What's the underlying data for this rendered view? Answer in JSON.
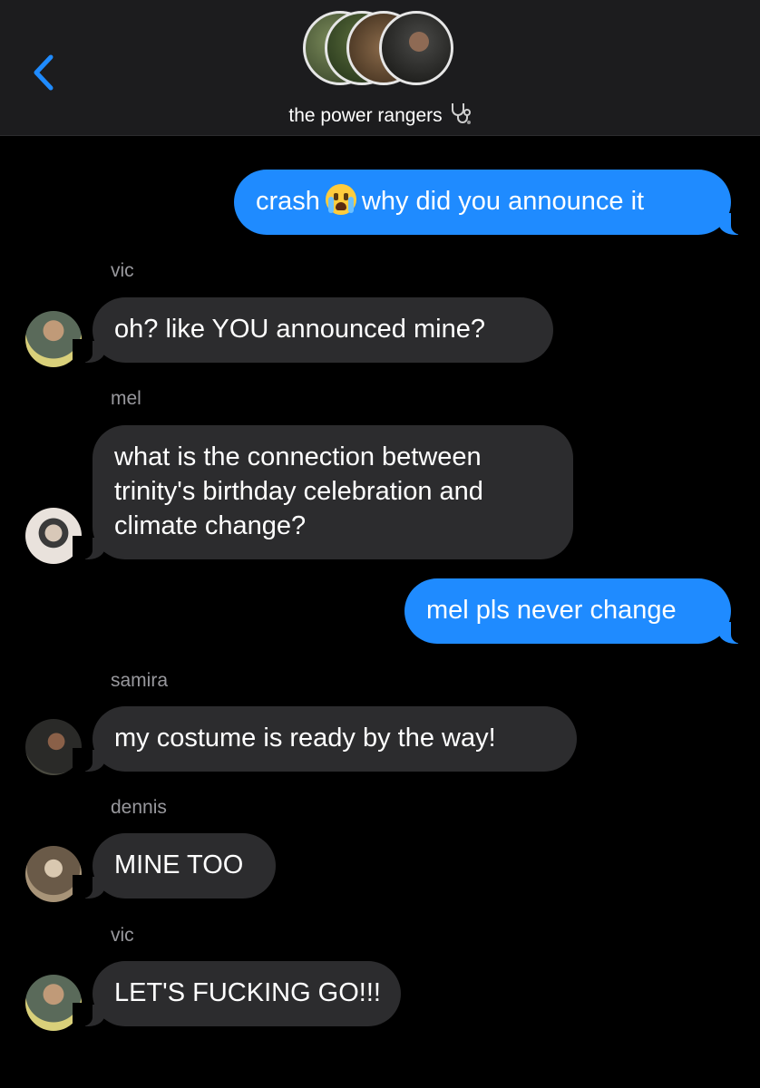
{
  "header": {
    "title": "the power rangers",
    "back_icon": "chevron-left-icon",
    "title_icon": "stethoscope-icon",
    "accent": "#1f8bff"
  },
  "messages": [
    {
      "type": "sent",
      "text_before": "crash",
      "emoji": "loudly-crying-face",
      "text_after": "why did you announce it"
    },
    {
      "type": "received",
      "sender": "vic",
      "text": "oh? like YOU announced mine?"
    },
    {
      "type": "received",
      "sender": "mel",
      "text": "what is the connection between trinity's birthday celebration and climate change?"
    },
    {
      "type": "sent",
      "text": "mel pls never change"
    },
    {
      "type": "received",
      "sender": "samira",
      "text": "my costume is ready by the way!"
    },
    {
      "type": "received",
      "sender": "dennis",
      "text": "MINE TOO"
    },
    {
      "type": "received",
      "sender": "vic",
      "text": "LET'S FUCKING GO!!!"
    }
  ]
}
